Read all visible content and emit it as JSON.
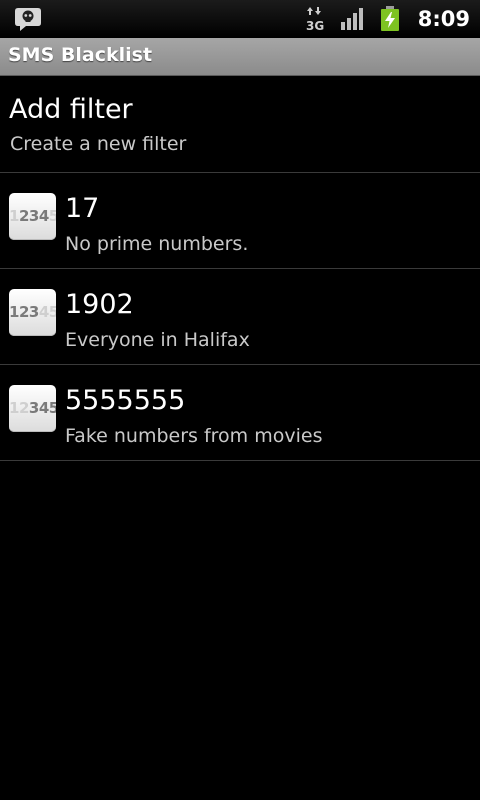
{
  "status_bar": {
    "time": "8:09",
    "network_label": "3G",
    "icons": [
      "blacklist-notification-icon",
      "network-3g-icon",
      "signal-icon",
      "battery-charging-icon"
    ]
  },
  "app": {
    "title": "SMS Blacklist"
  },
  "add_filter": {
    "title": "Add filter",
    "subtitle": "Create a new filter"
  },
  "filters": [
    {
      "number": "17",
      "description": "No prime numbers.",
      "badge": [
        "1",
        "2",
        "3",
        "4",
        "5"
      ]
    },
    {
      "number": "1902",
      "description": "Everyone in Halifax",
      "badge": [
        "1",
        "2",
        "3",
        "4",
        "5"
      ]
    },
    {
      "number": "5555555",
      "description": "Fake numbers from movies",
      "badge": [
        "1",
        "2",
        "3",
        "4",
        "5"
      ]
    }
  ],
  "colors": {
    "background": "#000000",
    "titlebar": "#999999",
    "battery": "#7ec322"
  }
}
